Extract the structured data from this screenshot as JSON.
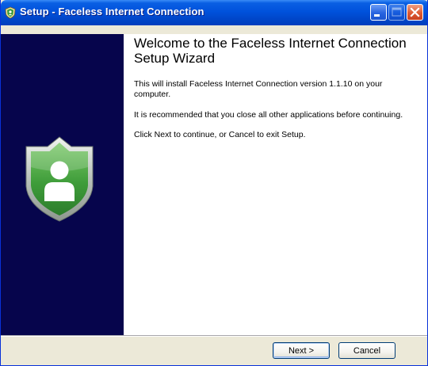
{
  "window": {
    "title": "Setup - Faceless Internet Connection"
  },
  "titlebar_buttons": {
    "minimize": "minimize-icon",
    "maximize": "maximize-icon",
    "close": "close-icon"
  },
  "content": {
    "heading": "Welcome to the Faceless Internet Connection Setup Wizard",
    "paragraphs": [
      "This will install Faceless Internet Connection version 1.1.10 on your computer.",
      "It is recommended that you close all other applications before continuing.",
      "Click Next to continue, or Cancel to exit Setup."
    ]
  },
  "buttons": {
    "next": "Next >",
    "cancel": "Cancel"
  },
  "colors": {
    "sidebar": "#06054c",
    "titlebar": "#0052dc",
    "shield_green": "#3c9e3a"
  },
  "icons": {
    "title_icon": "setup-shield-icon",
    "sidebar_image": "shield-user-icon"
  }
}
